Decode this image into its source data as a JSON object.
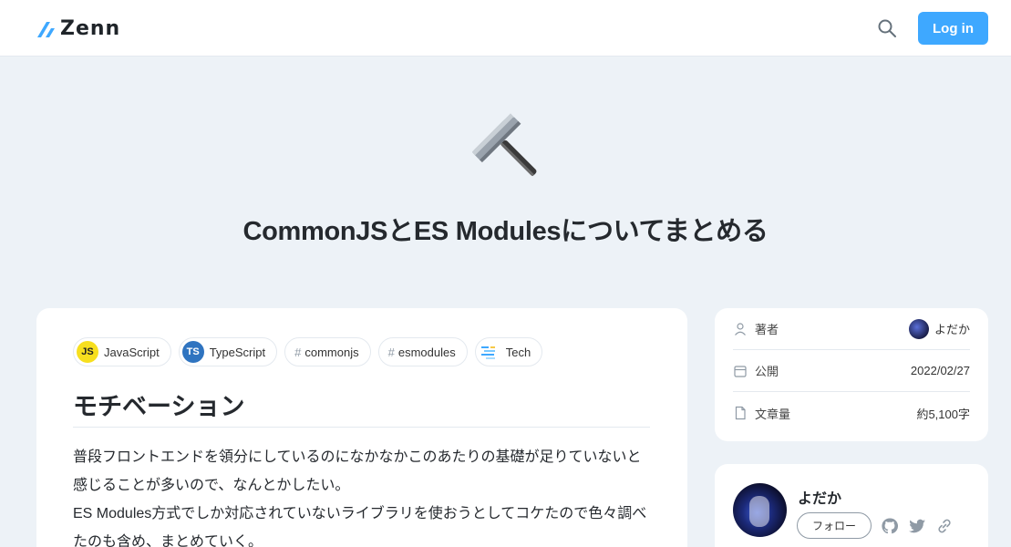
{
  "header": {
    "logo_text": "Zenn",
    "login_label": "Log in",
    "search_icon": "search-icon"
  },
  "article": {
    "emoji": "hammer",
    "title": "CommonJSとES Modulesについてまとめる",
    "tags": [
      {
        "label": "JavaScript",
        "icon": "JS"
      },
      {
        "label": "TypeScript",
        "icon": "TS"
      },
      {
        "label": "commonjs",
        "icon": "#"
      },
      {
        "label": "esmodules",
        "icon": "#"
      },
      {
        "label": "Tech",
        "icon": "tech-icon"
      }
    ],
    "section_heading": "モチベーション",
    "paragraphs": [
      "普段フロントエンドを領分にしているのになかなかこのあたりの基礎が足りていないと感じることが多いので、なんとかしたい。",
      "ES Modules方式でしか対応されていないライブラリを使おうとしてコケたので色々調べたのも含め、まとめていく。"
    ]
  },
  "meta": {
    "author_label": "著者",
    "author_name": "よだか",
    "published_label": "公開",
    "published_date": "2022/02/27",
    "length_label": "文章量",
    "length_value": "約5,100字"
  },
  "author_card": {
    "name": "よだか",
    "follow_label": "フォロー"
  },
  "colors": {
    "accent": "#3ea8ff",
    "background": "#edf2f7"
  }
}
